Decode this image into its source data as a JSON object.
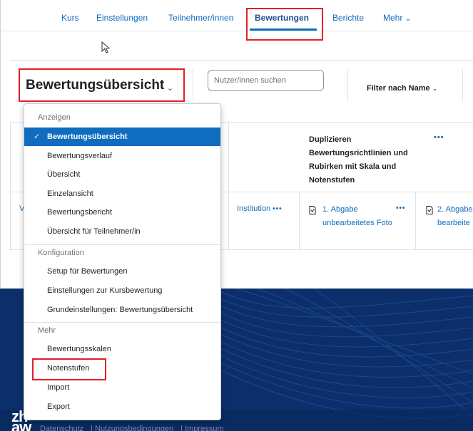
{
  "nav": {
    "items": [
      "Kurs",
      "Einstellungen",
      "Teilnehmer/innen",
      "Bewertungen",
      "Berichte",
      "Mehr"
    ],
    "active": "Bewertungen",
    "more_chevron": "⌄"
  },
  "header": {
    "title": "Bewertungsübersicht",
    "title_chevron": "⌄",
    "search_placeholder": "Nutzer/innen suchen",
    "filter_label": "Filter nach Name",
    "filter_chevron": "⌄"
  },
  "table": {
    "category_header": "Duplizieren Bewertungsrichtlinien und Rubirken mit Skala und Notenstufen",
    "more_dots": "•••",
    "left_truncated": "V",
    "columns": [
      {
        "label": "Institution"
      },
      {
        "label": "1. Abgabe unbearbeitetes Foto"
      },
      {
        "label": "2. Abgabe bearbeite"
      }
    ]
  },
  "menu": {
    "sections": [
      {
        "title": "Anzeigen",
        "items": [
          "Bewertungsübersicht",
          "Bewertungsverlauf",
          "Übersicht",
          "Einzelansicht",
          "Bewertungsbericht",
          "Übersicht für Teilnehmer/in"
        ]
      },
      {
        "title": "Konfiguration",
        "items": [
          "Setup für Bewertungen",
          "Einstellungen zur Kursbewertung",
          "Grundeinstellungen: Bewertungsübersicht"
        ]
      },
      {
        "title": "Mehr",
        "items": [
          "Bewertungsskalen",
          "Notenstufen",
          "Import",
          "Export"
        ]
      }
    ],
    "selected": "Bewertungsübersicht",
    "check": "✓"
  },
  "footer": {
    "logo_top": "zh",
    "logo_bottom": "aw",
    "links": [
      "Datenschutz",
      "Nutzungsbedingungen",
      "Impressum"
    ]
  },
  "colors": {
    "accent": "#0f6cbf",
    "highlight": "#e41e26",
    "footer_bg": "#0c2f6b"
  }
}
